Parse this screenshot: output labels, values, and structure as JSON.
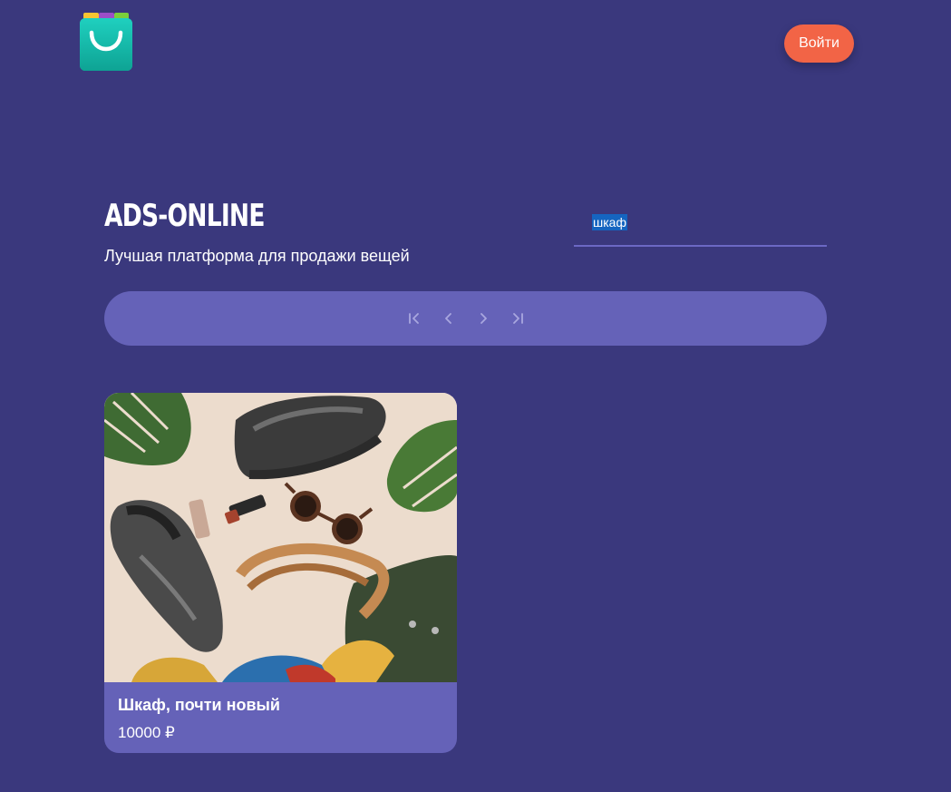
{
  "header": {
    "logo_icon": "shopping-bag-icon",
    "login_label": "Войти"
  },
  "hero": {
    "title": "ADS-ONLINE",
    "subtitle": "Лучшая платформа для продажи вещей"
  },
  "search": {
    "value": "шкаф"
  },
  "pagination": {
    "icons": [
      "first-page-icon",
      "previous-page-icon",
      "next-page-icon",
      "last-page-icon"
    ]
  },
  "listings": [
    {
      "title": "Шкаф, почти новый",
      "price": "10000 ₽",
      "image_icon": "product-photo"
    }
  ],
  "colors": {
    "background": "#3a387d",
    "accent": "#f26446",
    "panel": "#6562b8",
    "search_underline": "#6b68c4"
  }
}
